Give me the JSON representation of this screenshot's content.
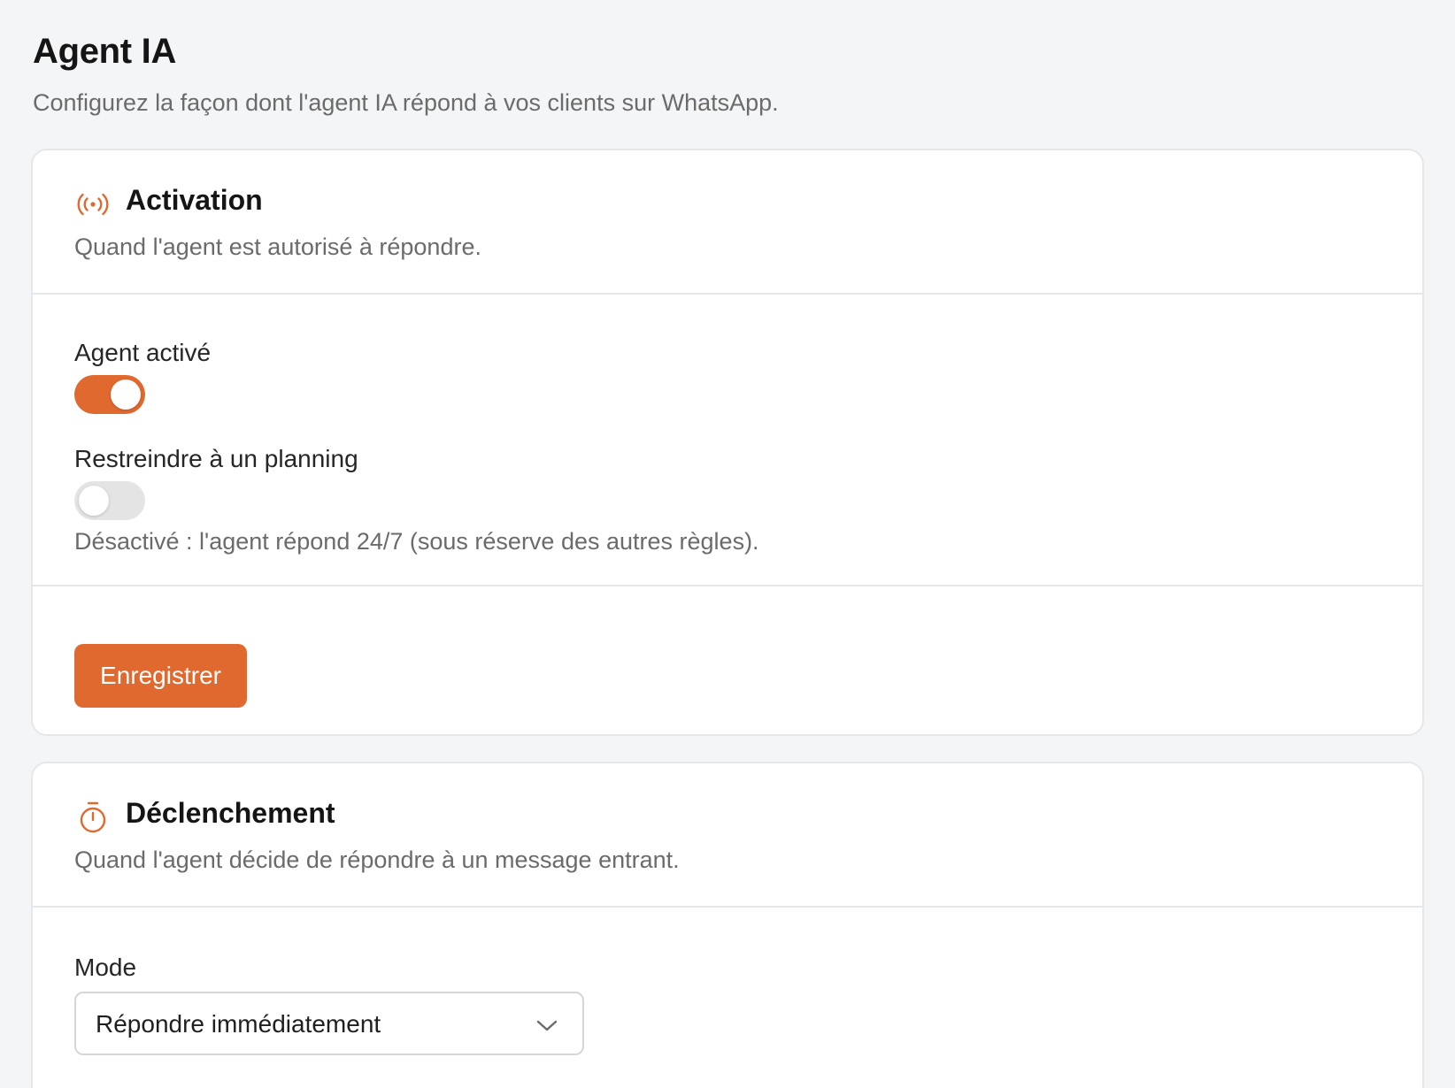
{
  "page": {
    "title": "Agent IA",
    "subtitle": "Configurez la façon dont l'agent IA répond à vos clients sur WhatsApp."
  },
  "colors": {
    "accent": "#e0692f",
    "toggle_off": "#e4e4e4",
    "muted_text": "#6b6b6b",
    "border": "#e6e7ea"
  },
  "activation": {
    "icon": "broadcast-icon",
    "title": "Activation",
    "description": "Quand l'agent est autorisé à répondre.",
    "agent_active": {
      "label": "Agent activé",
      "enabled": true
    },
    "schedule": {
      "label": "Restreindre à un planning",
      "enabled": false,
      "helper": "Désactivé : l'agent répond 24/7 (sous réserve des autres règles)."
    },
    "save_label": "Enregistrer"
  },
  "trigger": {
    "icon": "stopwatch-icon",
    "title": "Déclenchement",
    "description": "Quand l'agent décide de répondre à un message entrant.",
    "mode": {
      "label": "Mode",
      "selected": "Répondre immédiatement"
    }
  }
}
